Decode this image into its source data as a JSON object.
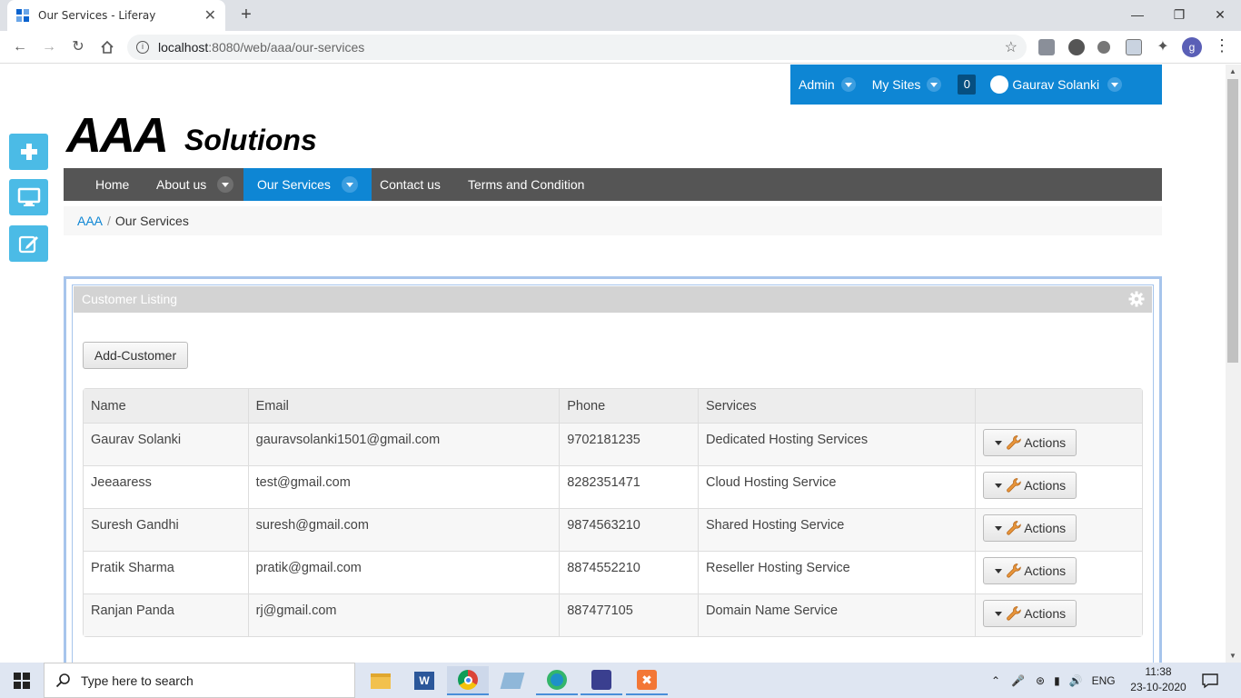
{
  "browser": {
    "tab_title": "Our Services - Liferay",
    "tab_close": "✕",
    "new_tab": "+",
    "url_host": "localhost",
    "url_rest": ":8080/web/aaa/our-services",
    "profile_initial": "g"
  },
  "dockbar": {
    "admin": "Admin",
    "my_sites": "My Sites",
    "notifications": "0",
    "user": "Gaurav Solanki"
  },
  "logo": {
    "part1": "AAA",
    "part2": "Solutions"
  },
  "nav": {
    "items": [
      {
        "label": "Home"
      },
      {
        "label": "About us"
      },
      {
        "label": "Our Services"
      },
      {
        "label": "Contact us"
      },
      {
        "label": "Terms and Condition"
      }
    ]
  },
  "breadcrumb": {
    "root": "AAA",
    "separator": "/",
    "current": "Our Services"
  },
  "portlet": {
    "title": "Customer Listing",
    "add_button": "Add-Customer",
    "columns": [
      "Name",
      "Email",
      "Phone",
      "Services",
      ""
    ],
    "action_label": "Actions",
    "rows": [
      {
        "name": "Gaurav Solanki",
        "email": "gauravsolanki1501@gmail.com",
        "phone": "9702181235",
        "service": "Dedicated Hosting Services"
      },
      {
        "name": "Jeeaaress",
        "email": "test@gmail.com",
        "phone": "8282351471",
        "service": "Cloud Hosting Service"
      },
      {
        "name": "Suresh Gandhi",
        "email": "suresh@gmail.com",
        "phone": "9874563210",
        "service": "Shared Hosting Service"
      },
      {
        "name": "Pratik Sharma",
        "email": "pratik@gmail.com",
        "phone": "8874552210",
        "service": "Reseller Hosting Service"
      },
      {
        "name": "Ranjan Panda",
        "email": "rj@gmail.com",
        "phone": "887477105",
        "service": "Domain Name Service"
      }
    ]
  },
  "taskbar": {
    "search_placeholder": "Type here to search",
    "language": "ENG",
    "time": "11:38",
    "date": "23-10-2020"
  },
  "colors": {
    "accent": "#0e86d4",
    "nav_bg": "#555555",
    "rail": "#4bbbe6"
  }
}
